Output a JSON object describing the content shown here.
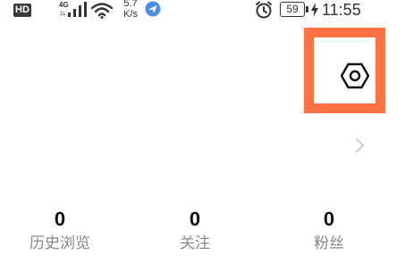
{
  "status_bar": {
    "hd": "HD",
    "network_type": "4G",
    "network_sub": "1L",
    "speed_value": "5.7",
    "speed_unit": "K/s",
    "battery_level": "59",
    "time": "11:55",
    "icons": [
      "signal-icon",
      "wifi-icon",
      "app-notification-icon",
      "alarm-icon",
      "battery-icon",
      "charging-icon"
    ]
  },
  "header": {
    "settings_icon": "settings-hexagon-icon",
    "highlight_color": "#ff7043"
  },
  "profile_row": {
    "chevron_icon": "chevron-right-icon"
  },
  "stats": [
    {
      "value": "0",
      "label": "历史浏览"
    },
    {
      "value": "0",
      "label": "关注"
    },
    {
      "value": "0",
      "label": "粉丝"
    }
  ]
}
